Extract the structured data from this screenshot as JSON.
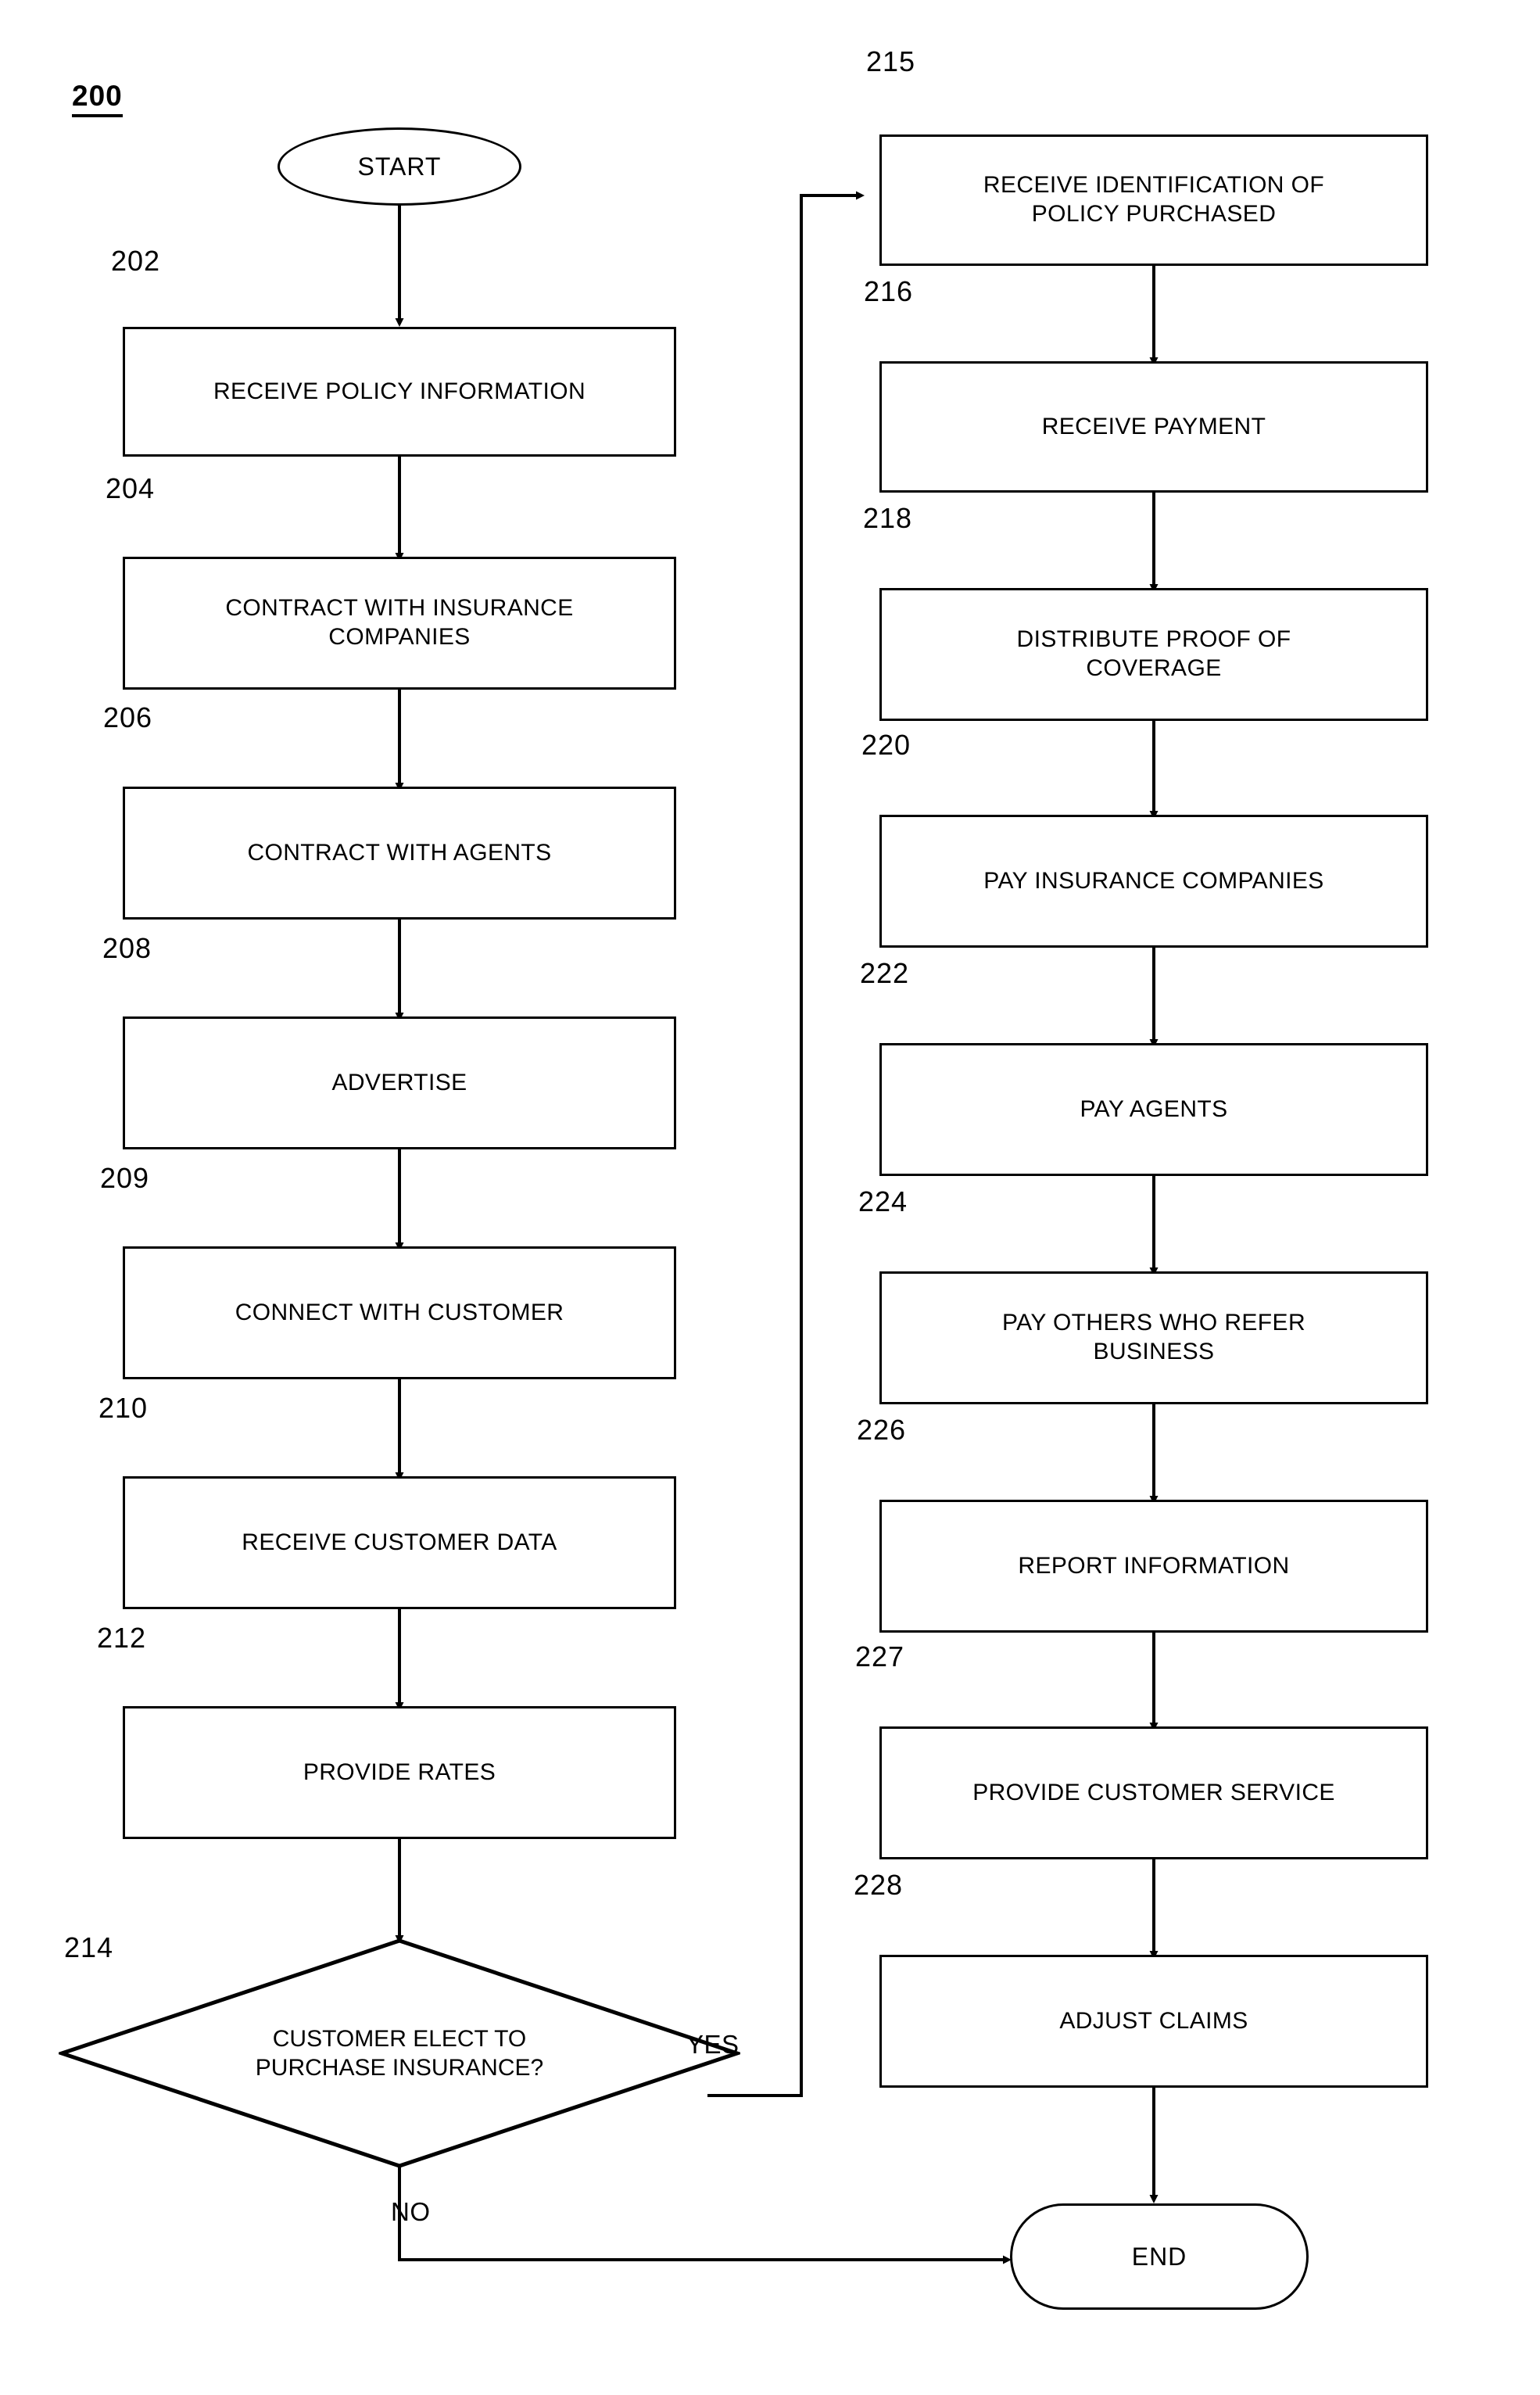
{
  "figure": {
    "number": "200",
    "title_ref": "200"
  },
  "terminals": {
    "start": "START",
    "end": "END"
  },
  "branches": {
    "yes": "YES",
    "no": "NO"
  },
  "left_column": [
    {
      "ref": "202",
      "label": "RECEIVE POLICY INFORMATION",
      "lines": [
        "RECEIVE POLICY INFORMATION"
      ]
    },
    {
      "ref": "204",
      "label": "CONTRACT WITH INSURANCE COMPANIES",
      "lines": [
        "CONTRACT WITH INSURANCE",
        "COMPANIES"
      ]
    },
    {
      "ref": "206",
      "label": "CONTRACT WITH AGENTS",
      "lines": [
        "CONTRACT WITH AGENTS"
      ]
    },
    {
      "ref": "208",
      "label": "ADVERTISE",
      "lines": [
        "ADVERTISE"
      ]
    },
    {
      "ref": "209",
      "label": "CONNECT WITH CUSTOMER",
      "lines": [
        "CONNECT WITH CUSTOMER"
      ]
    },
    {
      "ref": "210",
      "label": "RECEIVE CUSTOMER DATA",
      "lines": [
        "RECEIVE CUSTOMER DATA"
      ]
    },
    {
      "ref": "212",
      "label": "PROVIDE RATES",
      "lines": [
        "PROVIDE RATES"
      ]
    }
  ],
  "decision": {
    "ref": "214",
    "label": "CUSTOMER ELECT TO PURCHASE INSURANCE?",
    "lines": [
      "CUSTOMER ELECT TO",
      "PURCHASE INSURANCE?"
    ]
  },
  "right_column": [
    {
      "ref": "215",
      "label": "RECEIVE IDENTIFICATION OF POLICY PURCHASED",
      "lines": [
        "RECEIVE IDENTIFICATION OF",
        "POLICY PURCHASED"
      ]
    },
    {
      "ref": "216",
      "label": "RECEIVE PAYMENT",
      "lines": [
        "RECEIVE PAYMENT"
      ]
    },
    {
      "ref": "218",
      "label": "DISTRIBUTE PROOF OF COVERAGE",
      "lines": [
        "DISTRIBUTE PROOF OF",
        "COVERAGE"
      ]
    },
    {
      "ref": "220",
      "label": "PAY INSURANCE COMPANIES",
      "lines": [
        "PAY INSURANCE COMPANIES"
      ]
    },
    {
      "ref": "222",
      "label": "PAY AGENTS",
      "lines": [
        "PAY AGENTS"
      ]
    },
    {
      "ref": "224",
      "label": "PAY OTHERS WHO REFER BUSINESS",
      "lines": [
        "PAY OTHERS WHO REFER",
        "BUSINESS"
      ]
    },
    {
      "ref": "226",
      "label": "REPORT INFORMATION",
      "lines": [
        "REPORT INFORMATION"
      ]
    },
    {
      "ref": "227",
      "label": "PROVIDE CUSTOMER SERVICE",
      "lines": [
        "PROVIDE CUSTOMER SERVICE"
      ]
    },
    {
      "ref": "228",
      "label": "ADJUST CLAIMS",
      "lines": [
        "ADJUST CLAIMS"
      ]
    }
  ],
  "colors": {
    "stroke": "#000000",
    "background": "#ffffff"
  }
}
